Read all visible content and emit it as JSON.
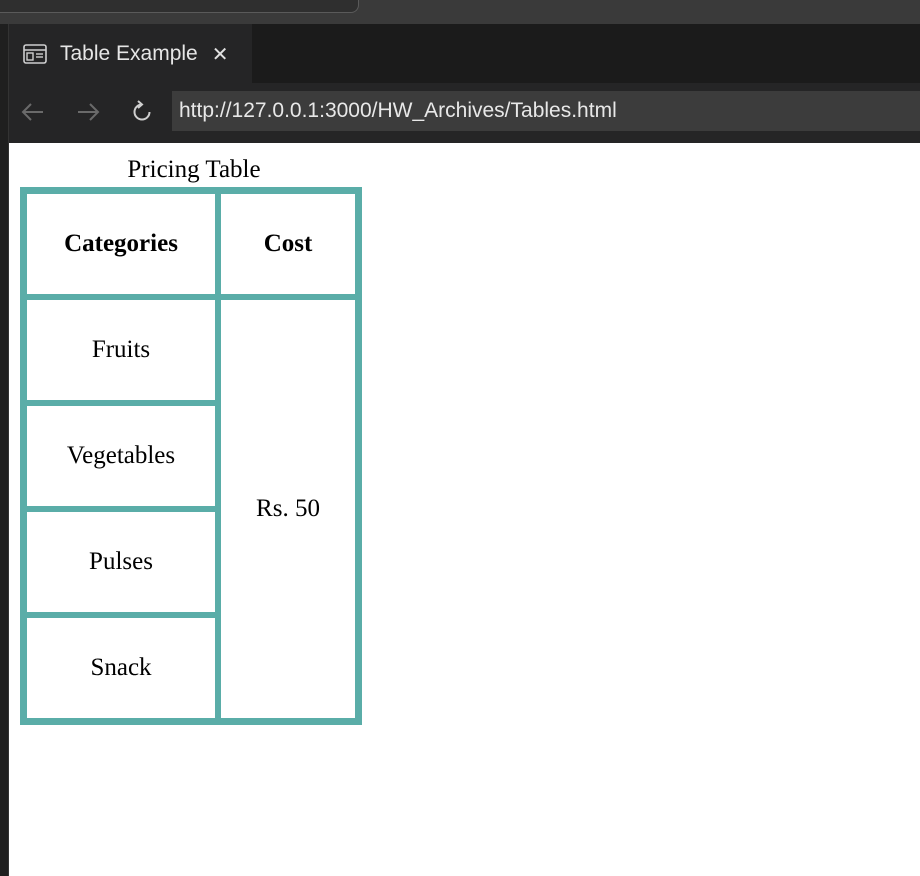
{
  "browser": {
    "tab": {
      "title": "Table Example",
      "close_glyph": "✕",
      "icon": "browser-page-icon"
    },
    "nav": {
      "back_icon": "arrow-left-icon",
      "forward_icon": "arrow-right-icon",
      "reload_icon": "reload-icon"
    },
    "address_bar": {
      "url": "http://127.0.0.1:3000/HW_Archives/Tables.html"
    }
  },
  "page": {
    "table": {
      "caption": "Pricing Table",
      "headers": [
        "Categories",
        "Cost"
      ],
      "rows": [
        {
          "category": "Fruits"
        },
        {
          "category": "Vegetables"
        },
        {
          "category": "Pulses"
        },
        {
          "category": "Snack"
        }
      ],
      "merged_cost": "Rs. 50"
    }
  },
  "colors": {
    "table_border": "#5aada8",
    "browser_chrome": "#252526",
    "address_bar_bg": "#3c3c3c"
  }
}
